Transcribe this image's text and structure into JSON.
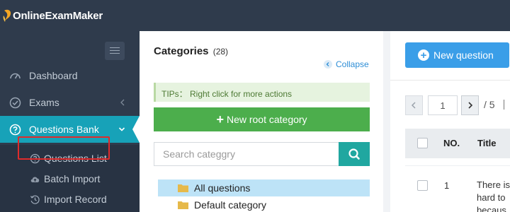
{
  "app": {
    "logo_text": "OnlineExamMaker",
    "accent_color": "#17a2b8"
  },
  "sidebar": {
    "items": [
      {
        "label": "Dashboard",
        "icon": "dashboard-icon"
      },
      {
        "label": "Exams",
        "icon": "check-circle-icon"
      },
      {
        "label": "Questions Bank",
        "icon": "question-circle-icon",
        "active": true
      }
    ],
    "subitems": [
      {
        "label": "Questions List",
        "icon": "question-circle-icon"
      },
      {
        "label": "Batch Import",
        "icon": "cloud-upload-icon",
        "highlighted": true
      },
      {
        "label": "Import Record",
        "icon": "history-icon"
      }
    ]
  },
  "categories": {
    "title": "Categories",
    "count": "(28)",
    "collapse_label": "Collapse",
    "tips": "TIPs： Right click for more actions",
    "new_root_label": "New root category",
    "search_placeholder": "Search categgry",
    "tree": [
      {
        "label": "All questions",
        "selected": true
      },
      {
        "label": "Default category",
        "selected": false
      }
    ]
  },
  "questions": {
    "new_question_label": "New question",
    "pagination": {
      "current_page": "1",
      "total": "/ 5"
    },
    "table": {
      "columns": [
        "NO.",
        "Title"
      ],
      "rows": [
        {
          "no": "1",
          "title": "There is hard to becaus"
        }
      ]
    }
  }
}
